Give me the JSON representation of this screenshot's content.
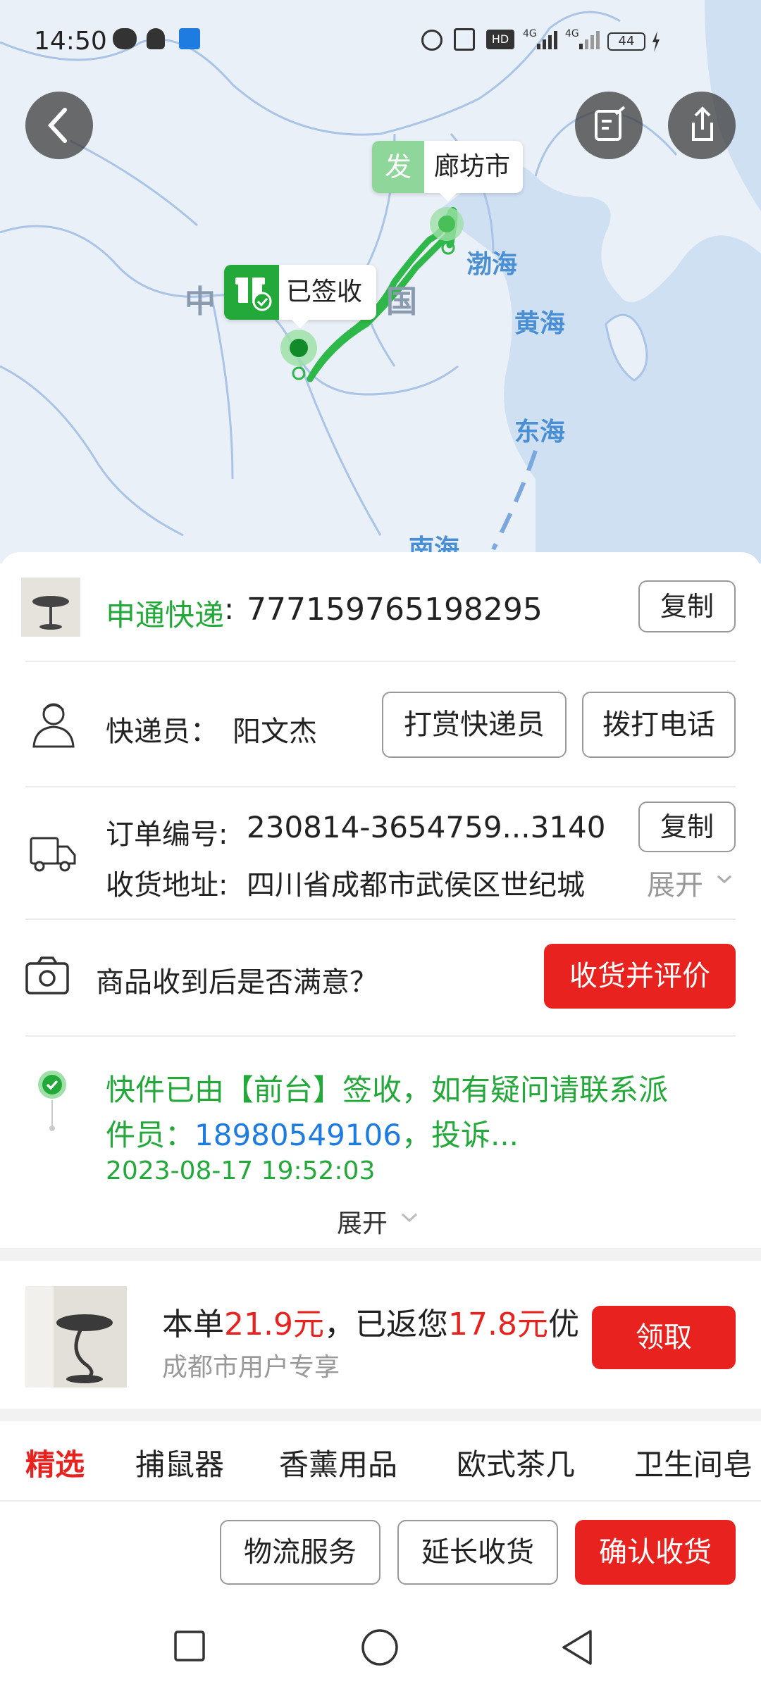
{
  "status_bar": {
    "time": "14:50",
    "battery": "44"
  },
  "map": {
    "origin_badge": "发",
    "origin_city": "廊坊市",
    "dest_status": "已签收",
    "labels": {
      "china_left": "中",
      "china_right": "国",
      "bohai": "渤海",
      "huanghai": "黄海",
      "donghai": "东海",
      "nanhai": "南海"
    }
  },
  "courier": {
    "company": "申通快递",
    "tracking_number": "777159765198295",
    "copy_label": "复制",
    "staff_label": "快递员：",
    "staff_name": "阳文杰",
    "tip_label": "打赏快递员",
    "call_label": "拨打电话"
  },
  "order": {
    "number_label": "订单编号:",
    "number_value": "230814-3654759...3140",
    "copy_label": "复制",
    "address_label": "收货地址:",
    "address_value": "四川省成都市武侯区世纪城",
    "expand_label": "展开"
  },
  "review": {
    "question": "商品收到后是否满意？",
    "button": "收货并评价"
  },
  "tracking": {
    "line1": "快件已由【前台】签收，如有疑问请联系派",
    "line2_prefix": "件员：",
    "phone": "18980549106",
    "line2_suffix": "，投诉...",
    "time": "2023-08-17  19:52:03",
    "expand_label": "展开"
  },
  "promo": {
    "prefix": "本单",
    "amount1": "21.9元",
    "mid": "，已返您",
    "amount2": "17.8元",
    "suffix": "优",
    "sub": "成都市用户专享",
    "button": "领取"
  },
  "categories": {
    "tabs": [
      "精选",
      "捕鼠器",
      "香薰用品",
      "欧式茶几",
      "卫生间皂"
    ]
  },
  "actions": {
    "logistics": "物流服务",
    "extend": "延长收货",
    "confirm": "确认收货"
  },
  "colors": {
    "accent_green": "#23a93a",
    "accent_red": "#e8231f",
    "link_blue": "#1e7ce0"
  }
}
